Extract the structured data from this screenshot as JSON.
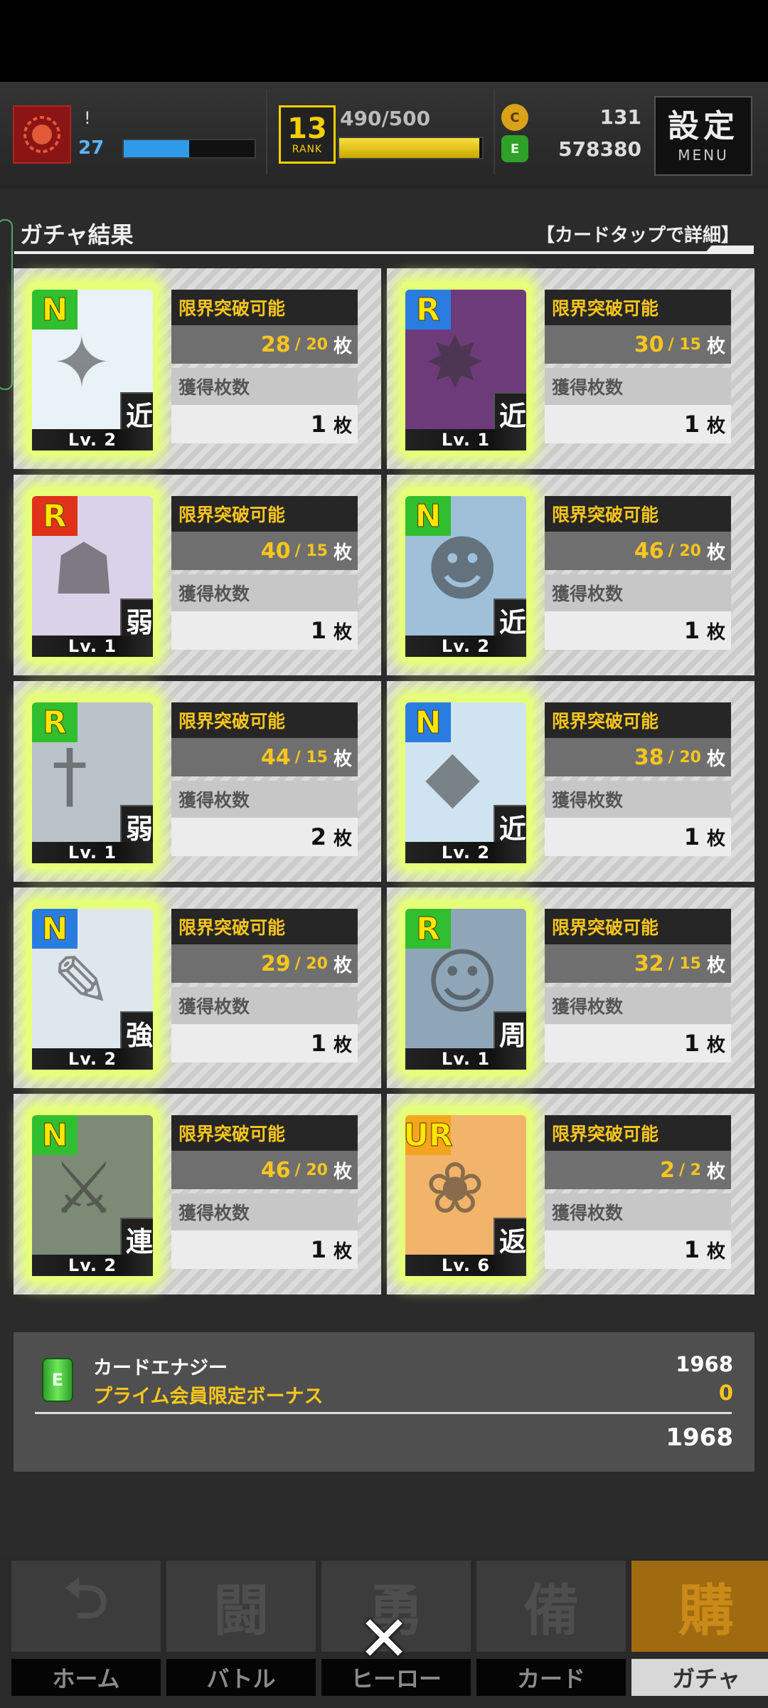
{
  "header": {
    "user_name": "!",
    "user_level": "27",
    "exp_fraction": 0.5,
    "rank_number": "13",
    "rank_label": "RANK",
    "stamina": "490/500",
    "stamina_fraction": 0.98,
    "coin_value": "131",
    "energy_value": "578380",
    "menu_kanji": "設定",
    "menu_label": "MENU"
  },
  "section": {
    "title": "ガチャ結果",
    "hint": "【カードタップで詳細】"
  },
  "labels": {
    "limit_break": "限界突破可能",
    "obtained": "獲得枚数",
    "unit": "枚"
  },
  "cards": [
    {
      "rarity": "N",
      "rarity_color": "#2fbf2f",
      "level": "Lv. 2",
      "type": "近",
      "count": "28",
      "max": "20",
      "obtained": "1",
      "art_icon": "wand-icon",
      "art_glyph": "✦",
      "bg": "#e9f2f7"
    },
    {
      "rarity": "R",
      "rarity_color": "#2a7de0",
      "level": "Lv. 1",
      "type": "近",
      "count": "30",
      "max": "15",
      "obtained": "1",
      "art_icon": "creature-icon",
      "art_glyph": "✸",
      "bg": "#6e3b7a"
    },
    {
      "rarity": "R",
      "rarity_color": "#e0321a",
      "level": "Lv. 1",
      "type": "弱",
      "count": "40",
      "max": "15",
      "obtained": "1",
      "art_icon": "beast-icon",
      "art_glyph": "☗",
      "bg": "#d9d2e8"
    },
    {
      "rarity": "N",
      "rarity_color": "#2fbf2f",
      "level": "Lv. 2",
      "type": "近",
      "count": "46",
      "max": "20",
      "obtained": "1",
      "art_icon": "officer-icon",
      "art_glyph": "☻",
      "bg": "#9fc0d8"
    },
    {
      "rarity": "R",
      "rarity_color": "#2fbf2f",
      "level": "Lv. 1",
      "type": "弱",
      "count": "44",
      "max": "15",
      "obtained": "2",
      "art_icon": "sword-icon",
      "art_glyph": "†",
      "bg": "#b9c3c9"
    },
    {
      "rarity": "N",
      "rarity_color": "#2a7de0",
      "level": "Lv. 2",
      "type": "近",
      "count": "38",
      "max": "20",
      "obtained": "1",
      "art_icon": "shield-icon",
      "art_glyph": "◆",
      "bg": "#cfe3f0"
    },
    {
      "rarity": "N",
      "rarity_color": "#2a7de0",
      "level": "Lv. 2",
      "type": "強",
      "count": "29",
      "max": "20",
      "obtained": "1",
      "art_icon": "scroll-icon",
      "art_glyph": "✎",
      "bg": "#dfe7ee"
    },
    {
      "rarity": "R",
      "rarity_color": "#2fbf2f",
      "level": "Lv. 1",
      "type": "周",
      "count": "32",
      "max": "15",
      "obtained": "1",
      "art_icon": "fighter-icon",
      "art_glyph": "☺",
      "bg": "#8fa6b8"
    },
    {
      "rarity": "N",
      "rarity_color": "#2fbf2f",
      "level": "Lv. 2",
      "type": "連",
      "count": "46",
      "max": "20",
      "obtained": "1",
      "art_icon": "warrior-icon",
      "art_glyph": "⚔",
      "bg": "#7d8a76"
    },
    {
      "rarity": "UR",
      "rarity_color": "#f4a51c",
      "level": "Lv. 6",
      "type": "返",
      "count": "2",
      "max": "2",
      "obtained": "1",
      "art_icon": "heroines-icon",
      "art_glyph": "❀",
      "bg": "#f2b36a"
    }
  ],
  "energy": {
    "label": "カードエナジー",
    "bonus_label": "プライム会員限定ボーナス",
    "value": "1968",
    "bonus_value": "0",
    "total": "1968"
  },
  "nav": {
    "items": [
      {
        "label": "ホーム",
        "icon": "home-icon",
        "glyph": "⮌"
      },
      {
        "label": "バトル",
        "icon": "gamepad-icon",
        "glyph": "闘"
      },
      {
        "label": "ヒーロー",
        "icon": "hero-icon",
        "glyph": "勇"
      },
      {
        "label": "カード",
        "icon": "cards-icon",
        "glyph": "備"
      },
      {
        "label": "ガチャ",
        "icon": "gacha-icon",
        "glyph": "購"
      }
    ],
    "active_index": 4,
    "close": "✕"
  }
}
